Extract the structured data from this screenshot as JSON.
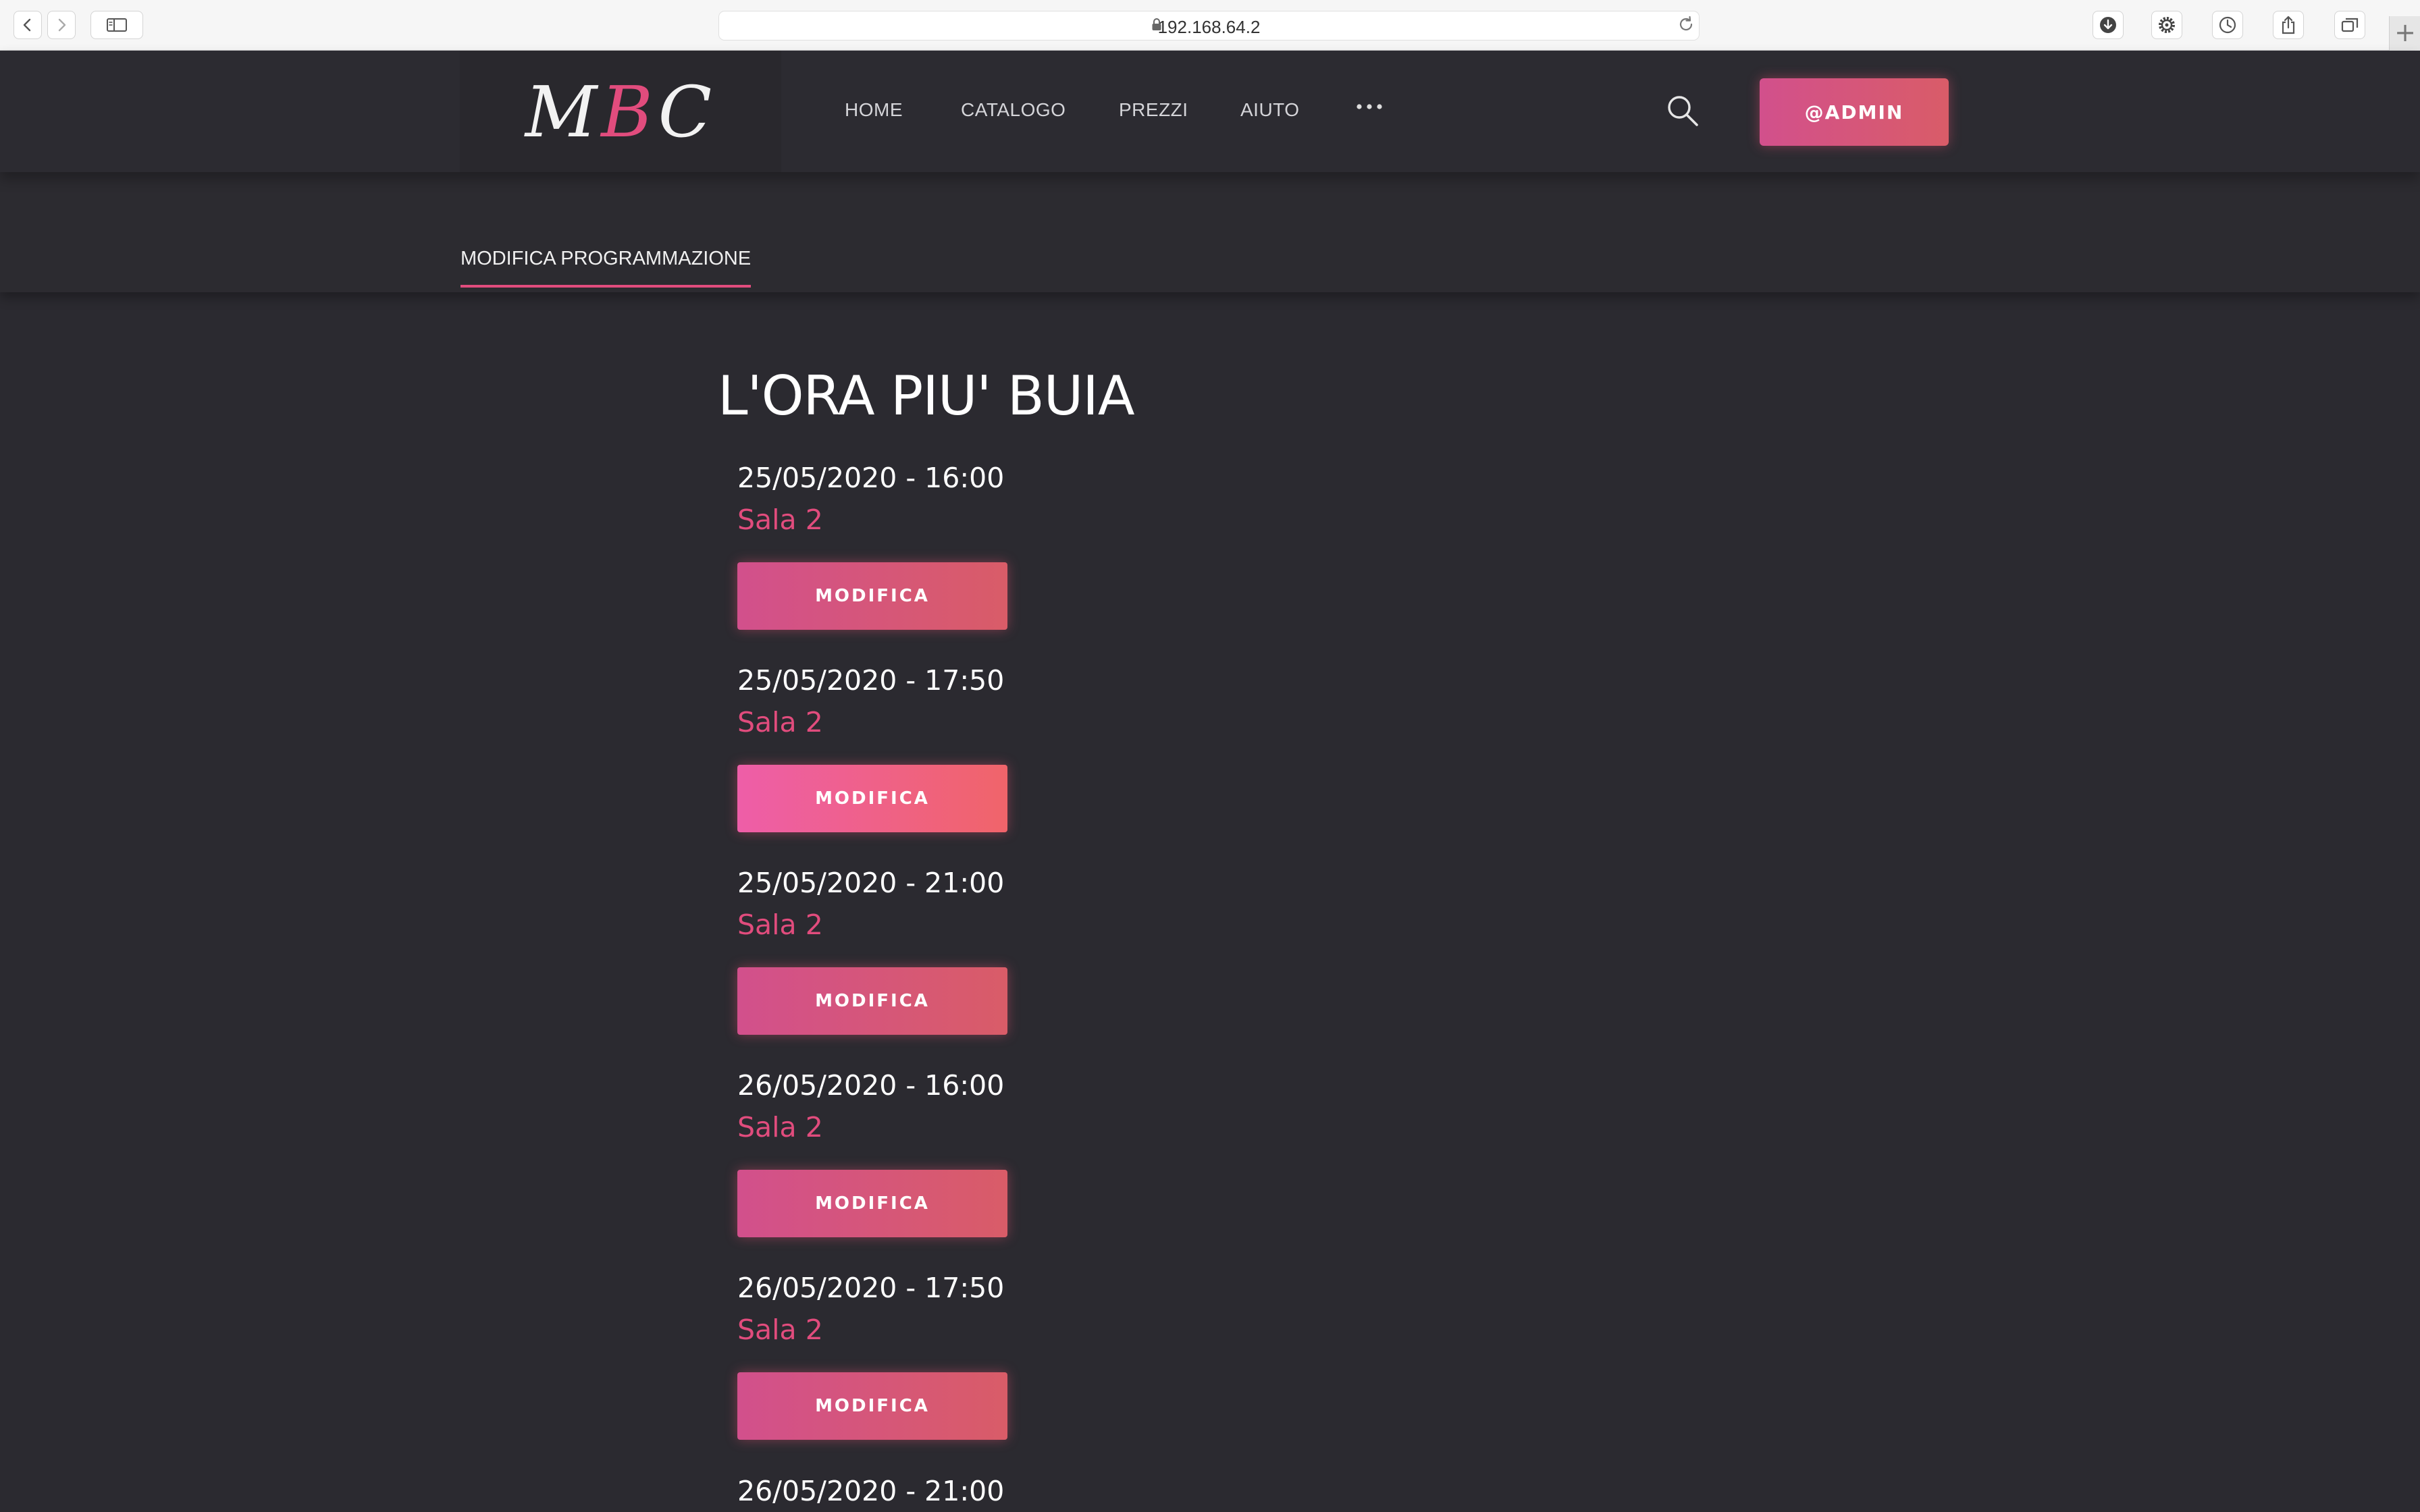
{
  "browser": {
    "url": "192.168.64.2",
    "new_tab": "+"
  },
  "header": {
    "logo_left": "M",
    "logo_mid": "B",
    "logo_right": "C",
    "nav": [
      "HOME",
      "CATALOGO",
      "PREZZI",
      "AIUTO"
    ],
    "more": "•••",
    "user_button": "@ADMIN"
  },
  "subheader": {
    "tab": "MODIFICA PROGRAMMAZIONE"
  },
  "main": {
    "title": "L'ORA PIU' BUIA",
    "slots": [
      {
        "datetime": "25/05/2020 - 16:00",
        "room": "Sala 2",
        "button": "MODIFICA"
      },
      {
        "datetime": "25/05/2020 - 17:50",
        "room": "Sala 2",
        "button": "MODIFICA"
      },
      {
        "datetime": "25/05/2020 - 21:00",
        "room": "Sala 2",
        "button": "MODIFICA"
      },
      {
        "datetime": "26/05/2020 - 16:00",
        "room": "Sala 2",
        "button": "MODIFICA"
      },
      {
        "datetime": "26/05/2020 - 17:50",
        "room": "Sala 2",
        "button": "MODIFICA"
      },
      {
        "datetime": "26/05/2020 - 21:00",
        "room": "",
        "button": ""
      }
    ]
  },
  "colors": {
    "accent": "#e14c7d",
    "button_gradient_start": "#d2508c",
    "button_gradient_end": "#d95c68",
    "background": "#2b2a30"
  },
  "icons": [
    "chevron-left-icon",
    "chevron-right-icon",
    "sidebar-icon",
    "lock-icon",
    "reload-icon",
    "download-icon",
    "gear-icon",
    "history-icon",
    "share-icon",
    "tabs-icon",
    "search-icon",
    "more-icon"
  ]
}
